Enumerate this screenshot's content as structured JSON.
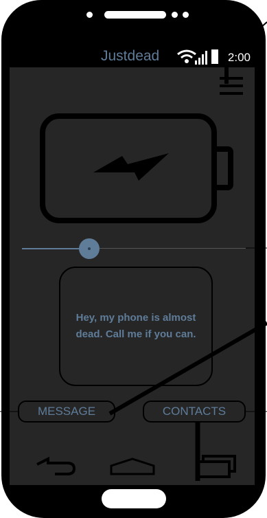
{
  "statusbar": {
    "carrier": "Justdead",
    "time": "2:00"
  },
  "icons": {
    "wifi": "wifi-icon",
    "signal": "signal-icon",
    "battery_status": "battery-icon",
    "menu": "hamburger-menu-icon",
    "battery_charging": "battery-charging-icon",
    "back": "back-arrow-icon",
    "home": "home-icon",
    "recent": "recent-apps-icon"
  },
  "slider": {
    "level": 0.3
  },
  "message_card": {
    "text": "Hey, my phone is almost dead. Call me if you can."
  },
  "buttons": {
    "message_label": "MESSAGE",
    "contacts_label": "CONTACTS"
  },
  "colors": {
    "accent": "#5f7c99",
    "screen_bg": "#262626",
    "device": "#000000"
  }
}
